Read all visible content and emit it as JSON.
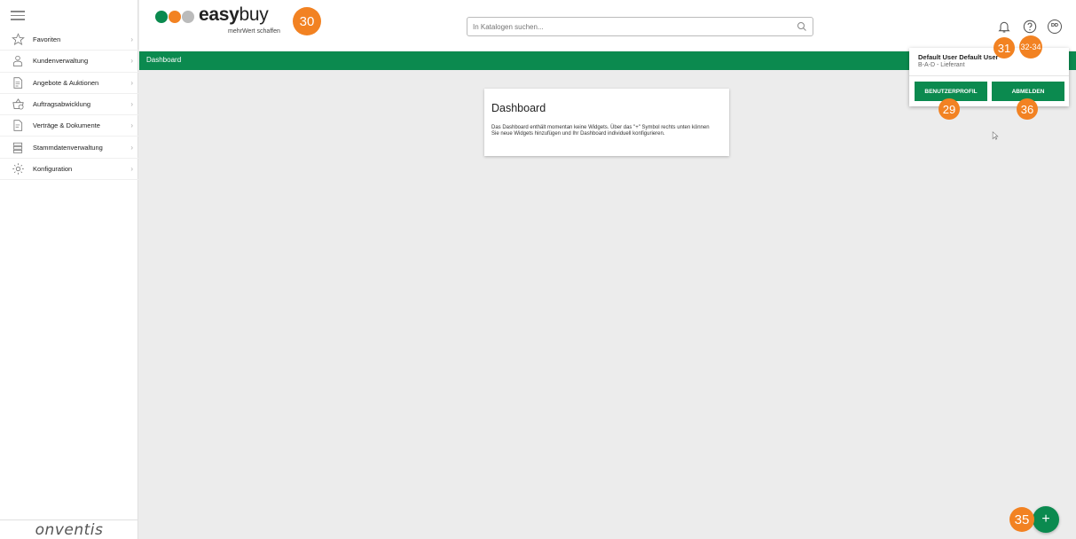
{
  "sidebar": {
    "items": [
      {
        "label": "Favoriten",
        "icon": "star-icon"
      },
      {
        "label": "Kundenverwaltung",
        "icon": "person-icon"
      },
      {
        "label": "Angebote & Auktionen",
        "icon": "document-icon"
      },
      {
        "label": "Auftragsabwicklung",
        "icon": "basket-clock-icon"
      },
      {
        "label": "Verträge & Dokumente",
        "icon": "document-edit-icon"
      },
      {
        "label": "Stammdatenverwaltung",
        "icon": "database-icon"
      },
      {
        "label": "Konfiguration",
        "icon": "gear-icon"
      }
    ],
    "footer_brand": "onventis"
  },
  "header": {
    "brand": "easy",
    "brand_suffix": "buy",
    "tagline": "mehrWert schaffen",
    "search_placeholder": "In Katalogen suchen...",
    "avatar_initials": "DD"
  },
  "breadcrumb": {
    "title": "Dashboard"
  },
  "dashboard_card": {
    "title": "Dashboard",
    "text": "Das Dashboard enthält momentan keine Widgets. Über das \"+\" Symbol rechts unten können Sie neue Widgets hinzufügen und Ihr Dashboard individuell konfigurieren."
  },
  "user_popup": {
    "name": "Default User Default User",
    "role": "B-A-D - Lieferant",
    "profile_button": "BENUTZERPROFIL",
    "logout_button": "ABMELDEN"
  },
  "markers": {
    "logo": "30",
    "bell": "31",
    "help": "32-34",
    "profile": "29",
    "logout": "36",
    "fab": "35"
  },
  "fab": {
    "symbol": "+"
  },
  "colors": {
    "accent_green": "#0b8a4f",
    "marker_orange": "#f28222"
  }
}
